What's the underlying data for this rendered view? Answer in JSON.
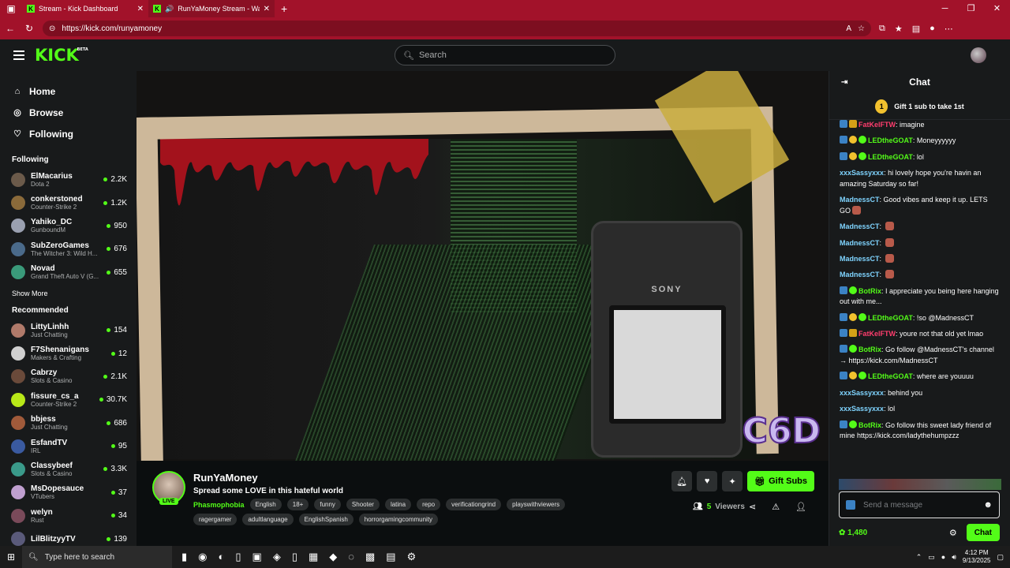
{
  "browser": {
    "tabs": [
      {
        "label": "Stream - Kick Dashboard",
        "active": false
      },
      {
        "label": "RunYaMoney Stream - Watch",
        "active": true
      }
    ],
    "new_tab": "+",
    "url": "https://kick.com/runyamoney"
  },
  "header": {
    "logo": "KICK",
    "logo_badge": "BETA",
    "search_placeholder": "Search"
  },
  "sidebar": {
    "nav": [
      {
        "label": "Home",
        "icon": "home-icon"
      },
      {
        "label": "Browse",
        "icon": "compass-icon"
      },
      {
        "label": "Following",
        "icon": "heart-icon"
      }
    ],
    "following_title": "Following",
    "following": [
      {
        "name": "ElMacarius",
        "category": "Dota 2",
        "viewers": "2.2K",
        "color": "#6b5a4a"
      },
      {
        "name": "conkerstoned",
        "category": "Counter-Strike 2",
        "viewers": "1.2K",
        "color": "#8a6a3a"
      },
      {
        "name": "Yahiko_DC",
        "category": "GunboundM",
        "viewers": "950",
        "color": "#9aa0b0"
      },
      {
        "name": "SubZeroGames",
        "category": "The Witcher 3: Wild H...",
        "viewers": "676",
        "color": "#4a6a8a"
      },
      {
        "name": "Novad",
        "category": "Grand Theft Auto V (G...",
        "viewers": "655",
        "color": "#3a9a7a"
      }
    ],
    "show_more": "Show More",
    "recommended_title": "Recommended",
    "recommended": [
      {
        "name": "LittyLinhh",
        "category": "Just Chatting",
        "viewers": "154",
        "color": "#b07a6a"
      },
      {
        "name": "F7Shenanigans",
        "category": "Makers & Crafting",
        "viewers": "12",
        "color": "#d0d0d0"
      },
      {
        "name": "Cabrzy",
        "category": "Slots & Casino",
        "viewers": "2.1K",
        "color": "#6a4a3a"
      },
      {
        "name": "fissure_cs_a",
        "category": "Counter-Strike 2",
        "viewers": "30.7K",
        "color": "#b8e818"
      },
      {
        "name": "bbjess",
        "category": "Just Chatting",
        "viewers": "686",
        "color": "#a05a3a"
      },
      {
        "name": "EsfandTV",
        "category": "IRL",
        "viewers": "95",
        "color": "#3a5aa0"
      },
      {
        "name": "Classybeef",
        "category": "Slots & Casino",
        "viewers": "3.3K",
        "color": "#3a9a8a"
      },
      {
        "name": "MsDopesauce",
        "category": "VTubers",
        "viewers": "37",
        "color": "#c0a0d0"
      },
      {
        "name": "welyn",
        "category": "Rust",
        "viewers": "34",
        "color": "#7a4a5a"
      },
      {
        "name": "LilBlitzyyTV",
        "category": "",
        "viewers": "139",
        "color": "#5a5a7a"
      }
    ]
  },
  "stream": {
    "streamer": "RunYaMoney",
    "live_label": "LIVE",
    "title": "Spread some LOVE in this hateful world",
    "game": "Phasmophobia",
    "tags": [
      "English",
      "18+",
      "funny",
      "Shooter",
      "latina",
      "repo",
      "verificationgrind",
      "playswithviewers",
      "ragergamer",
      "adultlanguage",
      "EnglishSpanish",
      "horrorgamingcommunity"
    ],
    "gift_label": "Gift Subs",
    "viewers_count": "5",
    "viewers_label": "Viewers",
    "overlay_logo": "C6D",
    "device_brand": "SONY"
  },
  "chat": {
    "title": "Chat",
    "pinned": {
      "coin": "1",
      "text": "Gift 1 sub to take 1st"
    },
    "messages": [
      {
        "user": "FatKelFTW",
        "text": "imagine",
        "color": "#ff3d6e",
        "badges": [
          "b-bot",
          "b-crown"
        ]
      },
      {
        "user": "LEDtheGOAT",
        "text": "Moneyyyyyy",
        "color": "#53fc18",
        "badges": [
          "b-bot",
          "b-gift",
          "b-ver"
        ]
      },
      {
        "user": "LEDtheGOAT",
        "text": "lol",
        "color": "#53fc18",
        "badges": [
          "b-bot",
          "b-gift",
          "b-ver"
        ]
      },
      {
        "user": "xxxSassyxxx",
        "text": "hi lovely hope you're havin an amazing Saturday so far!",
        "color": "#7fd4ff",
        "badges": []
      },
      {
        "user": "MadnessCT",
        "text": "Good vibes and keep it up. LETS GO",
        "color": "#7fd4ff",
        "badges": []
      },
      {
        "user": "MadnessCT",
        "text": "",
        "color": "#7fd4ff",
        "badges": []
      },
      {
        "user": "MadnessCT",
        "text": "",
        "color": "#7fd4ff",
        "badges": []
      },
      {
        "user": "MadnessCT",
        "text": "",
        "color": "#7fd4ff",
        "badges": []
      },
      {
        "user": "MadnessCT",
        "text": "",
        "color": "#7fd4ff",
        "badges": []
      },
      {
        "user": "BotRix",
        "text": "I appreciate you being here hanging out with me...",
        "color": "#53fc18",
        "badges": [
          "b-bot",
          "b-ver"
        ]
      },
      {
        "user": "LEDtheGOAT",
        "text": "!so @MadnessCT",
        "color": "#53fc18",
        "badges": [
          "b-bot",
          "b-gift",
          "b-ver"
        ]
      },
      {
        "user": "FatKelFTW",
        "text": "youre not that old yet lmao",
        "color": "#ff3d6e",
        "badges": [
          "b-bot",
          "b-crown"
        ]
      },
      {
        "user": "BotRix",
        "text": "Go follow @MadnessCT's channel → https://kick.com/MadnessCT",
        "color": "#53fc18",
        "badges": [
          "b-bot",
          "b-ver"
        ]
      },
      {
        "user": "LEDtheGOAT",
        "text": "where are youuuu",
        "color": "#53fc18",
        "badges": [
          "b-bot",
          "b-gift",
          "b-ver"
        ]
      },
      {
        "user": "xxxSassyxxx",
        "text": "behind you",
        "color": "#7fd4ff",
        "badges": []
      },
      {
        "user": "xxxSassyxxx",
        "text": "lol",
        "color": "#7fd4ff",
        "badges": []
      },
      {
        "user": "BotRix",
        "text": "Go follow this sweet lady friend of mine https://kick.com/ladythehumpzzz",
        "color": "#53fc18",
        "badges": [
          "b-bot",
          "b-ver"
        ]
      }
    ],
    "input_placeholder": "Send a message",
    "points": "1,480",
    "send_label": "Chat"
  },
  "taskbar": {
    "search_placeholder": "Type here to search",
    "time": "4:12 PM",
    "date": "9/13/2025"
  }
}
